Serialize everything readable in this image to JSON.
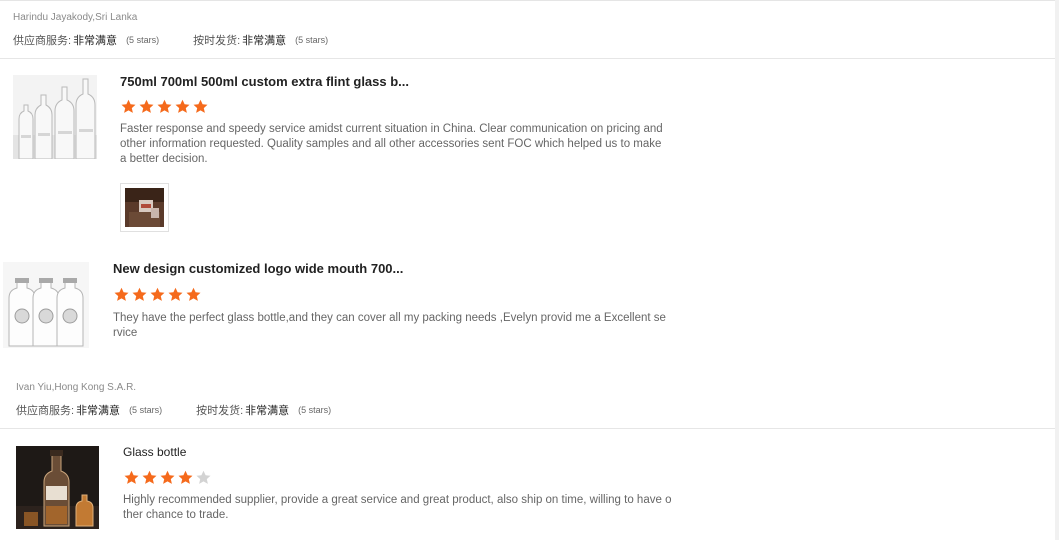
{
  "colors": {
    "star_filled": "#f56a1c",
    "star_empty": "#d3d3d3"
  },
  "reviews": [
    {
      "reviewer": "Harindu Jayakody,Sri Lanka",
      "service_label": "供应商服务:",
      "service_value": "非常满意",
      "service_stars": "(5 stars)",
      "ship_label": "按时发货:",
      "ship_value": "非常满意",
      "ship_stars": "(5 stars)"
    },
    {
      "reviewer": "Ivan Yiu,Hong Kong S.A.R.",
      "service_label": "供应商服务:",
      "service_value": "非常满意",
      "service_stars": "(5 stars)",
      "ship_label": "按时发货:",
      "ship_value": "非常满意",
      "ship_stars": "(5 stars)"
    }
  ],
  "products": [
    {
      "icon": "glass-bottles-thumbnail",
      "title": "750ml 700ml 500ml custom extra flint glass b...",
      "rating": 5,
      "comment_lines": [
        "Faster response and speedy service amidst current situation in China. Clear communication on pricing and",
        "other information requested. Quality samples and all other accessories sent FOC which helped us to make",
        "a better decision."
      ],
      "attachment_icon": "review-photo-thumbnail"
    },
    {
      "icon": "wide-mouth-bottles-thumbnail",
      "title": "New design customized logo wide mouth 700...",
      "rating": 5,
      "comment_lines": [
        "They have the perfect glass bottle,and they can cover all my packing needs ,Evelyn provid me a Excellent se",
        "rvice"
      ]
    },
    {
      "icon": "liquor-bottle-thumbnail",
      "title": "Glass bottle",
      "rating": 4,
      "comment_lines": [
        "Highly recommended supplier, provide a great service and great product, also ship on time, willing to have o",
        "ther chance to trade."
      ]
    }
  ]
}
